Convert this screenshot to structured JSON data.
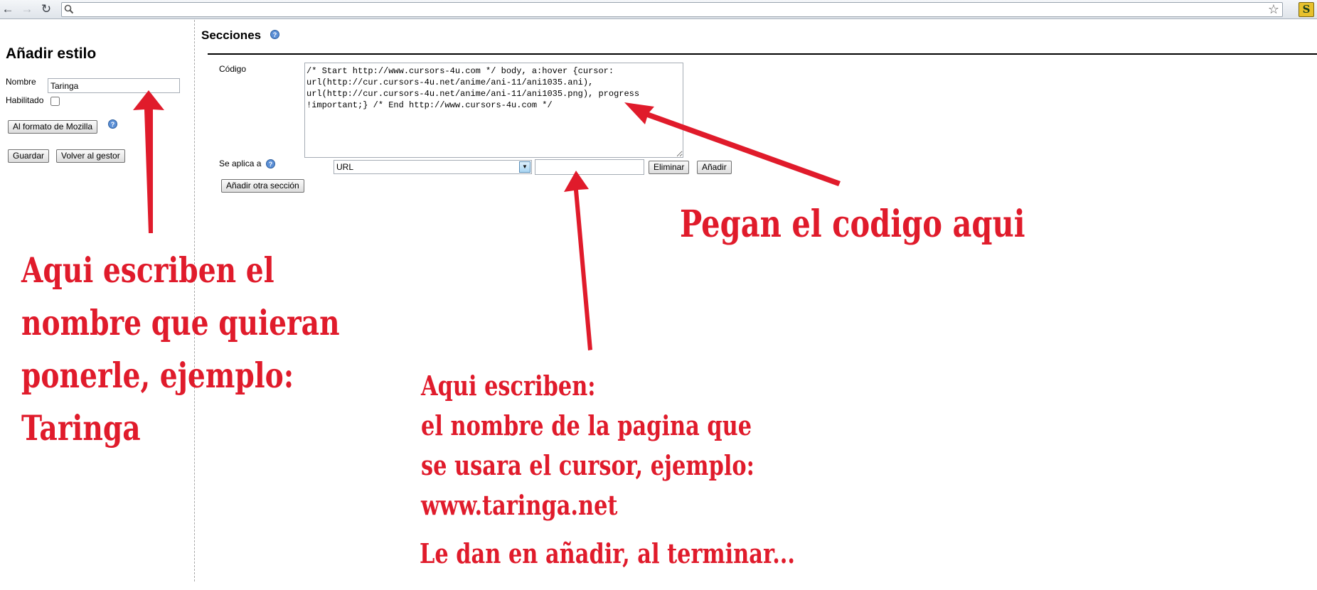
{
  "browser": {
    "back_icon": "back-arrow-icon",
    "forward_icon": "forward-arrow-icon",
    "reload_icon": "reload-icon",
    "address_value": "",
    "star_icon": "bookmark-star-icon",
    "extension_icon": "stylish-extension-icon",
    "extension_letter": "S"
  },
  "editor": {
    "title": "Añadir estilo",
    "name_label": "Nombre",
    "name_value": "Taringa",
    "enabled_label": "Habilitado",
    "enabled_checked": false,
    "mozilla_button": "Al formato de Mozilla",
    "save_button": "Guardar",
    "back_button": "Volver al gestor"
  },
  "sections": {
    "title": "Secciones",
    "code_label": "Código",
    "code_value": "/* Start http://www.cursors-4u.com */ body, a:hover {cursor:\nurl(http://cur.cursors-4u.net/anime/ani-11/ani1035.ani),\nurl(http://cur.cursors-4u.net/anime/ani-11/ani1035.png), progress\n!important;} /* End http://www.cursors-4u.com */",
    "applies_label": "Se aplica a",
    "applies_type": "URL",
    "applies_value": "",
    "remove_button": "Eliminar",
    "add_button": "Añadir",
    "add_section_button": "Añadir otra sección"
  },
  "annotations": {
    "name_note": [
      "Aqui escriben el",
      "nombre que quieran",
      "ponerle, ejemplo:"
    ],
    "name_example": "Taringa",
    "code_note": "Pegan el codigo aqui",
    "page_note": [
      "Aqui escriben:",
      "el nombre de la pagina que",
      "se usara el cursor, ejemplo:"
    ],
    "page_example": "www.taringa.net",
    "add_note": "Le dan en añadir, al terminar...",
    "text_color": "#e01b2b",
    "example_color": "#3a3fbf",
    "arrow_color": "#e01b2b"
  },
  "colors": {
    "help_icon": "#5b8fd6",
    "toolbar": "#dfe4ea"
  }
}
